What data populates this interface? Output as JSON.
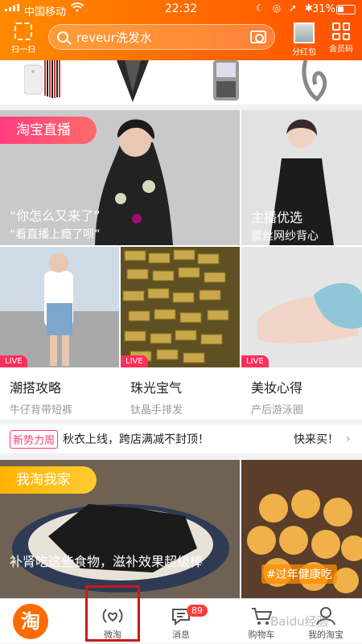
{
  "status": {
    "carrier": "中国移动",
    "time": "22:32",
    "battery": "31%"
  },
  "header": {
    "scan_label": "扫一扫",
    "search_query": "reveur洗发水",
    "redpacket_label": "分红包",
    "member_label": "会员码"
  },
  "live": {
    "tag": "淘宝直播",
    "main": {
      "line1": "“你怎么又来了”",
      "line2": "“看直播上瘾了呗”"
    },
    "side": {
      "title": "主播优选",
      "subtitle": "蕾丝网纱背心"
    },
    "cards": [
      {
        "badge": "LIVE",
        "title": "潮搭攻略",
        "subtitle": "牛仔背带短裤"
      },
      {
        "badge": "LIVE",
        "title": "珠光宝气",
        "subtitle": "钛晶手排发"
      },
      {
        "badge": "LIVE",
        "title": "美妆心得",
        "subtitle": "产后游泳圈"
      }
    ]
  },
  "promo": {
    "badge": "新势力周",
    "text": "秋衣上线，跨店满减不封顶！",
    "more": "快来买！"
  },
  "home": {
    "tag": "我淘我家",
    "caption": "补肾吃这些食物，滋补效果超级棒",
    "hashtag": "#过年健康吃"
  },
  "tabbar": {
    "logo": "淘",
    "items": [
      {
        "label": "微淘"
      },
      {
        "label": "消息",
        "badge": "89"
      },
      {
        "label": "购物车"
      },
      {
        "label": "我的淘宝"
      }
    ]
  },
  "watermark": "Baidu经验"
}
